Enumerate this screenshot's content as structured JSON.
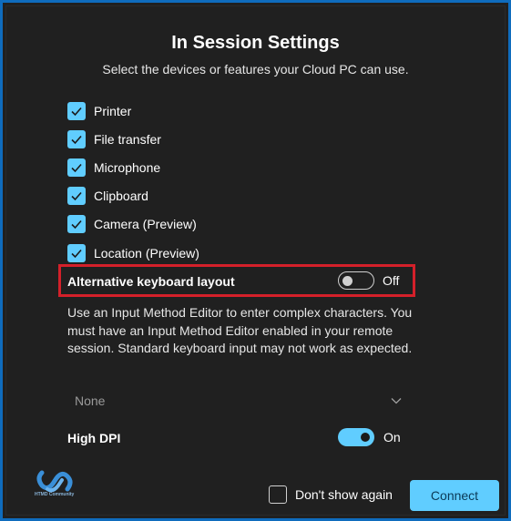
{
  "dialog": {
    "title": "In Session Settings",
    "subtitle": "Select the devices or features your Cloud PC can use."
  },
  "devices": [
    {
      "label": "Printer",
      "checked": true
    },
    {
      "label": "File transfer",
      "checked": true
    },
    {
      "label": "Microphone",
      "checked": true
    },
    {
      "label": "Clipboard",
      "checked": true
    },
    {
      "label": "Camera (Preview)",
      "checked": true
    },
    {
      "label": "Location (Preview)",
      "checked": true
    }
  ],
  "alternative_keyboard": {
    "label": "Alternative keyboard layout",
    "state_label": "Off",
    "enabled": false,
    "description": "Use an Input Method Editor to enter complex characters. You must have an Input Method Editor enabled in your remote session. Standard keyboard input may not work as expected.",
    "dropdown_value": "None"
  },
  "high_dpi": {
    "label": "High DPI",
    "state_label": "On",
    "enabled": true
  },
  "footer": {
    "dont_show_label": "Don't show again",
    "dont_show_checked": false,
    "connect_label": "Connect",
    "logo_text": "HTMD Community"
  },
  "colors": {
    "accent": "#60cdff",
    "highlight_border": "#d4202a",
    "window_border": "#0f6cbd",
    "background": "#202020"
  }
}
